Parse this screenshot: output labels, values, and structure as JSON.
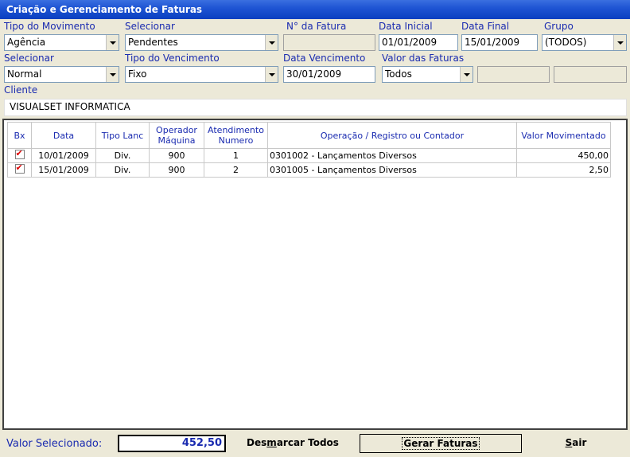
{
  "window": {
    "title": "Criação e Gerenciamento de Faturas"
  },
  "filters": {
    "tipo_movimento": {
      "label": "Tipo do Movimento",
      "value": "Agência"
    },
    "selecionar1": {
      "label": "Selecionar",
      "value": "Pendentes"
    },
    "num_fatura": {
      "label": "N° da Fatura",
      "value": ""
    },
    "data_inicial": {
      "label": "Data Inicial",
      "value": "01/01/2009"
    },
    "data_final": {
      "label": "Data Final",
      "value": "15/01/2009"
    },
    "grupo": {
      "label": "Grupo",
      "value": "(TODOS)"
    },
    "selecionar2": {
      "label": "Selecionar",
      "value": "Normal"
    },
    "tipo_vencimento": {
      "label": "Tipo do Vencimento",
      "value": "Fixo"
    },
    "data_vencimento": {
      "label": "Data Vencimento",
      "value": "30/01/2009"
    },
    "valor_faturas": {
      "label": "Valor das Faturas",
      "value": "Todos"
    },
    "cliente": {
      "label": "Cliente",
      "value": "VISUALSET INFORMATICA"
    }
  },
  "table": {
    "headers": {
      "bx": "Bx",
      "data": "Data",
      "tipo": "Tipo Lanc",
      "operador1": "Operador",
      "operador2": "Máquina",
      "atend1": "Atendimento",
      "atend2": "Numero",
      "operacao": "Operação / Registro ou Contador",
      "valor": "Valor Movimentado"
    },
    "rows": [
      {
        "checked": true,
        "data": "10/01/2009",
        "tipo": "Div.",
        "operador": "900",
        "atendimento": "1",
        "operacao": "0301002 - Lançamentos Diversos",
        "valor": "450,00"
      },
      {
        "checked": true,
        "data": "15/01/2009",
        "tipo": "Div.",
        "operador": "900",
        "atendimento": "2",
        "operacao": "0301005 - Lançamentos Diversos",
        "valor": "2,50"
      }
    ]
  },
  "footer": {
    "valor_label": "Valor Selecionado:",
    "valor": "452,50",
    "desmarcar_pre": "Des",
    "desmarcar_u": "m",
    "desmarcar_post": "arcar Todos",
    "gerar": "Gerar Faturas",
    "sair_u": "S",
    "sair_post": "air"
  }
}
